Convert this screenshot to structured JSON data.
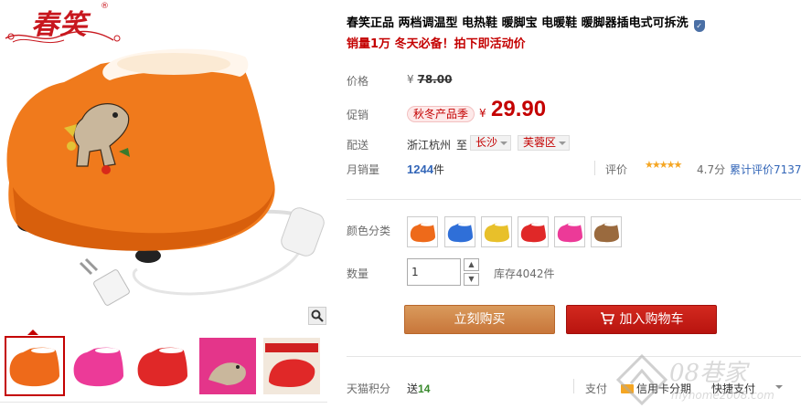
{
  "brand": {
    "name": "春笑",
    "reg": "®"
  },
  "product": {
    "title": "春笑正品 两档调温型 电热鞋 暖脚宝 电暖鞋 暖脚器插电式可拆洗",
    "subtitle": "销量1万 冬天必备！拍下即活动价"
  },
  "price": {
    "label": "价格",
    "original_currency": "¥",
    "original": "78.00",
    "promo_label": "促销",
    "promo_tag": "秋冬产品季",
    "currency": "¥",
    "current": "29.90"
  },
  "shipping": {
    "label": "配送",
    "from": "浙江杭州",
    "to_word": "至",
    "city": "长沙",
    "district": "芙蓉区"
  },
  "sales": {
    "label": "月销量",
    "count": "1244",
    "unit": "件",
    "rating_label": "评价",
    "stars": "★★★★★",
    "score": "4.7分",
    "total_reviews": "累计评价7137"
  },
  "colors": {
    "label": "颜色分类",
    "options": [
      "橙色",
      "蓝色",
      "黄色",
      "红色",
      "玫红",
      "咖啡色"
    ],
    "swatch_hex": [
      "#ee6a1a",
      "#2f6fd8",
      "#e8c02a",
      "#e02828",
      "#ec3a98",
      "#9a6a3e"
    ]
  },
  "quantity": {
    "label": "数量",
    "value": "1",
    "stock": "库存4042件"
  },
  "buttons": {
    "buy_now": "立刻购买",
    "add_to_cart": "加入购物车"
  },
  "points": {
    "label": "天猫积分",
    "prefix": "送",
    "value": "14"
  },
  "payment": {
    "label": "支付",
    "credit": "信用卡分期",
    "quick": "快捷支付"
  },
  "watermark": {
    "text": "08巷家",
    "url": "myhome2008.com"
  },
  "theme": {
    "accent": "#c40000",
    "buy": "#c8763a",
    "cart": "#b8140f",
    "link": "#3366b8"
  }
}
